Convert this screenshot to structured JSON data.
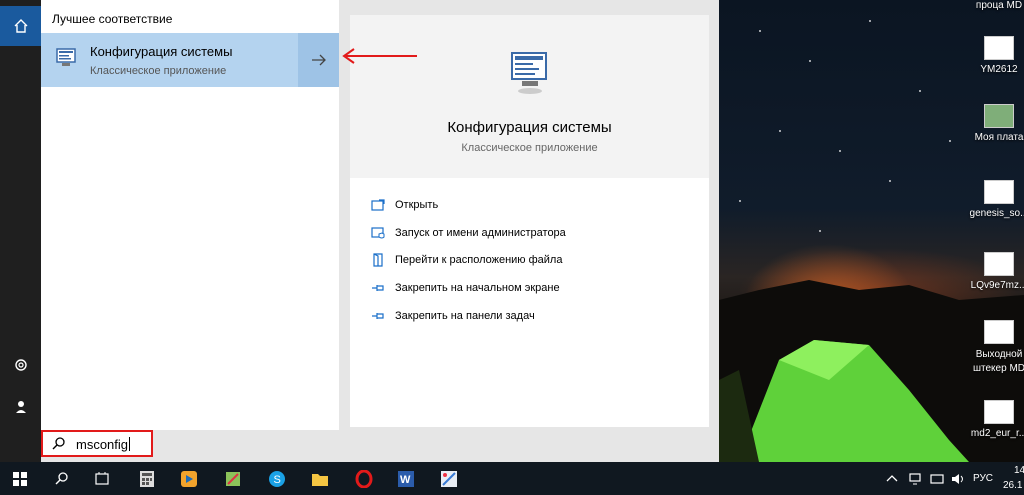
{
  "search_panel": {
    "best_match_heading": "Лучшее соответствие",
    "best_match": {
      "title": "Конфигурация системы",
      "subtitle": "Классическое приложение"
    },
    "detail": {
      "title": "Конфигурация системы",
      "subtitle": "Классическое приложение",
      "actions": [
        {
          "label": "Открыть",
          "icon": "open-icon"
        },
        {
          "label": "Запуск от имени администратора",
          "icon": "run-as-admin-icon"
        },
        {
          "label": "Перейти к расположению файла",
          "icon": "file-location-icon"
        },
        {
          "label": "Закрепить на начальном экране",
          "icon": "pin-start-icon"
        },
        {
          "label": "Закрепить на панели задач",
          "icon": "pin-taskbar-icon"
        }
      ]
    },
    "search_query": "msconfig"
  },
  "desktop_icons": [
    {
      "label": "проца MD"
    },
    {
      "label": "YM2612"
    },
    {
      "label": "Моя плата"
    },
    {
      "label": "genesis_so..."
    },
    {
      "label": "LQv9e7mz..."
    },
    {
      "label": "Выходной штекер MD"
    },
    {
      "label": "md2_eur_r..."
    }
  ],
  "taskbar": {
    "apps": [
      "start-icon",
      "search-icon",
      "task-view-icon",
      "calculator-icon",
      "media-player-icon",
      "notepad-icon",
      "skype-icon",
      "file-explorer-icon",
      "opera-icon",
      "word-icon",
      "paint-icon"
    ],
    "tray": {
      "language": "РУС",
      "time": "14",
      "date": "26.1"
    }
  },
  "colors": {
    "accent": "#1a5a9e",
    "selection": "#b4d3ef",
    "annotation": "#e21a1a"
  }
}
